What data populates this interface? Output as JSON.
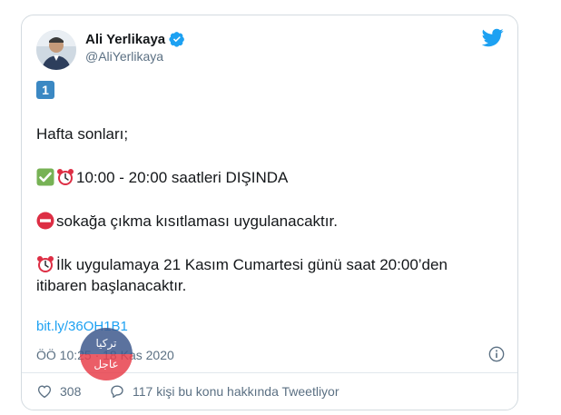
{
  "tweet": {
    "author_name": "Ali Yerlikaya",
    "author_handle": "@AliYerlikaya",
    "number_badge": "1",
    "line1": "Hafta sonları;",
    "line2": "10:00 - 20:00 saatleri DIŞINDA",
    "line3": "sokağa çıkma kısıtlaması uygulanacaktır.",
    "line4a": "İlk uygulamaya 21 Kasım Cumartesi günü saat 20:00’den",
    "line4b": "itibaren başlanacaktır.",
    "link": "bit.ly/36OH1B1",
    "timestamp": "ÖÖ 10:25 · 18 Kas 2020"
  },
  "actions": {
    "likes": "308",
    "conversation": "117 kişi bu konu hakkında Tweetliyor"
  },
  "watermark": {
    "top": "تركيا",
    "bottom": "عاجل"
  },
  "colors": {
    "link": "#1da1f2",
    "verified": "#1da1f2",
    "keycap": "#3b88c3",
    "muted": "#5b7083"
  },
  "icons": [
    "verified-badge-icon",
    "twitter-bird-icon",
    "check-emoji-icon",
    "alarm-clock-emoji-icon",
    "no-entry-emoji-icon",
    "info-icon",
    "heart-icon",
    "comment-icon"
  ]
}
